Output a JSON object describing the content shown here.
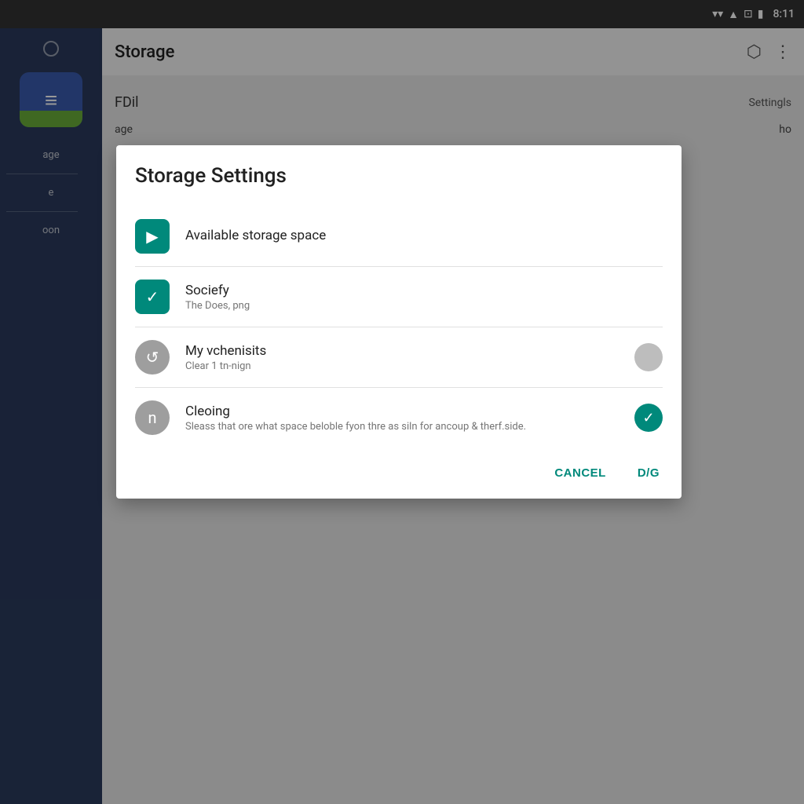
{
  "statusBar": {
    "time": "8:11",
    "icons": [
      "wifi",
      "signal",
      "sim",
      "battery"
    ]
  },
  "sidebar": {
    "circleLabel": "○",
    "appIconLabel": "≡",
    "labels": [
      "age",
      "e",
      "oon"
    ],
    "dividerCount": 2
  },
  "appBar": {
    "title": "Storage",
    "iconCube": "⬡",
    "iconMore": "⋮",
    "partialText": "FDil",
    "settingsLink": "Settingls"
  },
  "pageContent": {
    "leftPartial": "age",
    "rightPartial": "ho"
  },
  "dialog": {
    "title": "Storage Settings",
    "items": [
      {
        "id": "available-storage",
        "iconType": "teal-screen",
        "iconSymbol": "▶",
        "title": "Available storage space",
        "subtitle": "",
        "toggle": null
      },
      {
        "id": "sociefy",
        "iconType": "teal-check",
        "iconSymbol": "✓",
        "title": "Sociefy",
        "subtitle": "The Does, png",
        "toggle": null
      },
      {
        "id": "my-vchenisits",
        "iconType": "gray-circle",
        "iconSymbol": "↺",
        "title": "My vchenisits",
        "subtitle": "Clear 1 tn-nign",
        "toggle": "off"
      },
      {
        "id": "cleoing",
        "iconType": "gray-n",
        "iconSymbol": "n",
        "title": "Cleoing",
        "subtitle": "Sleass that ore what space beloble fyon thre as siln for ancoup & therf.side.",
        "toggle": "on"
      }
    ],
    "buttons": [
      {
        "id": "cancel",
        "label": "CANCEL"
      },
      {
        "id": "dg",
        "label": "D/G"
      }
    ]
  }
}
